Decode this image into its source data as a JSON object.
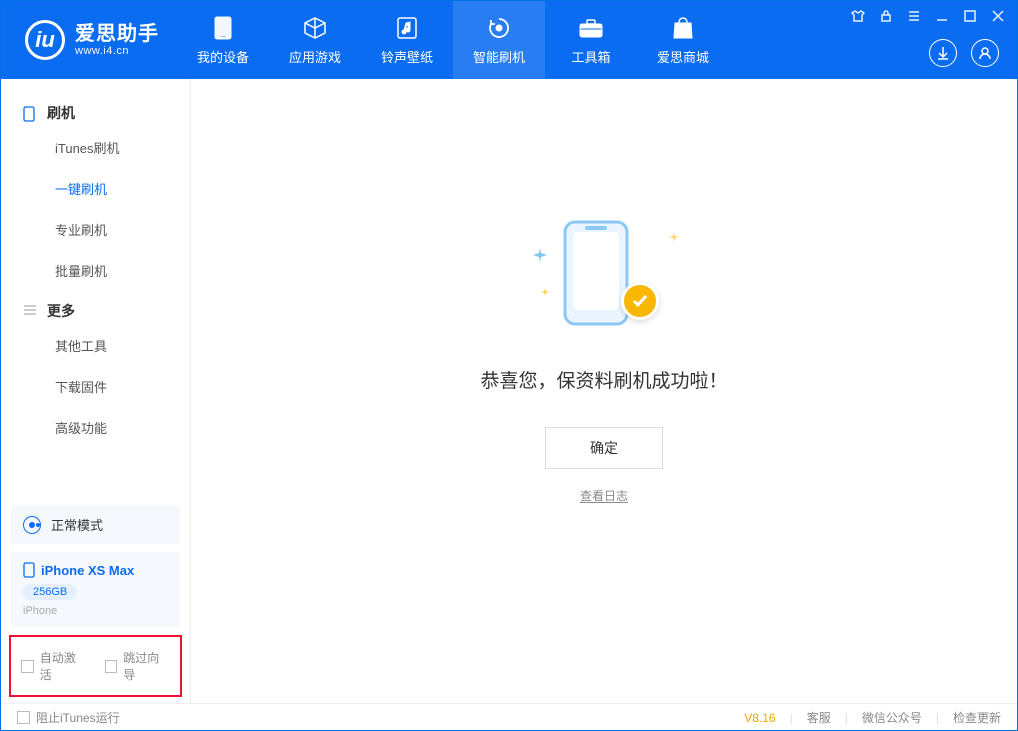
{
  "app": {
    "title": "爱思助手",
    "url": "www.i4.cn"
  },
  "nav": {
    "items": [
      {
        "label": "我的设备"
      },
      {
        "label": "应用游戏"
      },
      {
        "label": "铃声壁纸"
      },
      {
        "label": "智能刷机"
      },
      {
        "label": "工具箱"
      },
      {
        "label": "爱思商城"
      }
    ]
  },
  "sidebar": {
    "sec1": "刷机",
    "items1": [
      {
        "label": "iTunes刷机"
      },
      {
        "label": "一键刷机"
      },
      {
        "label": "专业刷机"
      },
      {
        "label": "批量刷机"
      }
    ],
    "sec2": "更多",
    "items2": [
      {
        "label": "其他工具"
      },
      {
        "label": "下载固件"
      },
      {
        "label": "高级功能"
      }
    ],
    "mode": "正常模式",
    "device": {
      "name": "iPhone XS Max",
      "capacity": "256GB",
      "type": "iPhone"
    },
    "opts": {
      "auto_activate": "自动激活",
      "skip_guide": "跳过向导"
    }
  },
  "main": {
    "message": "恭喜您，保资料刷机成功啦！",
    "ok": "确定",
    "view_log": "查看日志"
  },
  "footer": {
    "block_itunes": "阻止iTunes运行",
    "version": "V8.16",
    "support": "客服",
    "wechat": "微信公众号",
    "update": "检查更新"
  }
}
